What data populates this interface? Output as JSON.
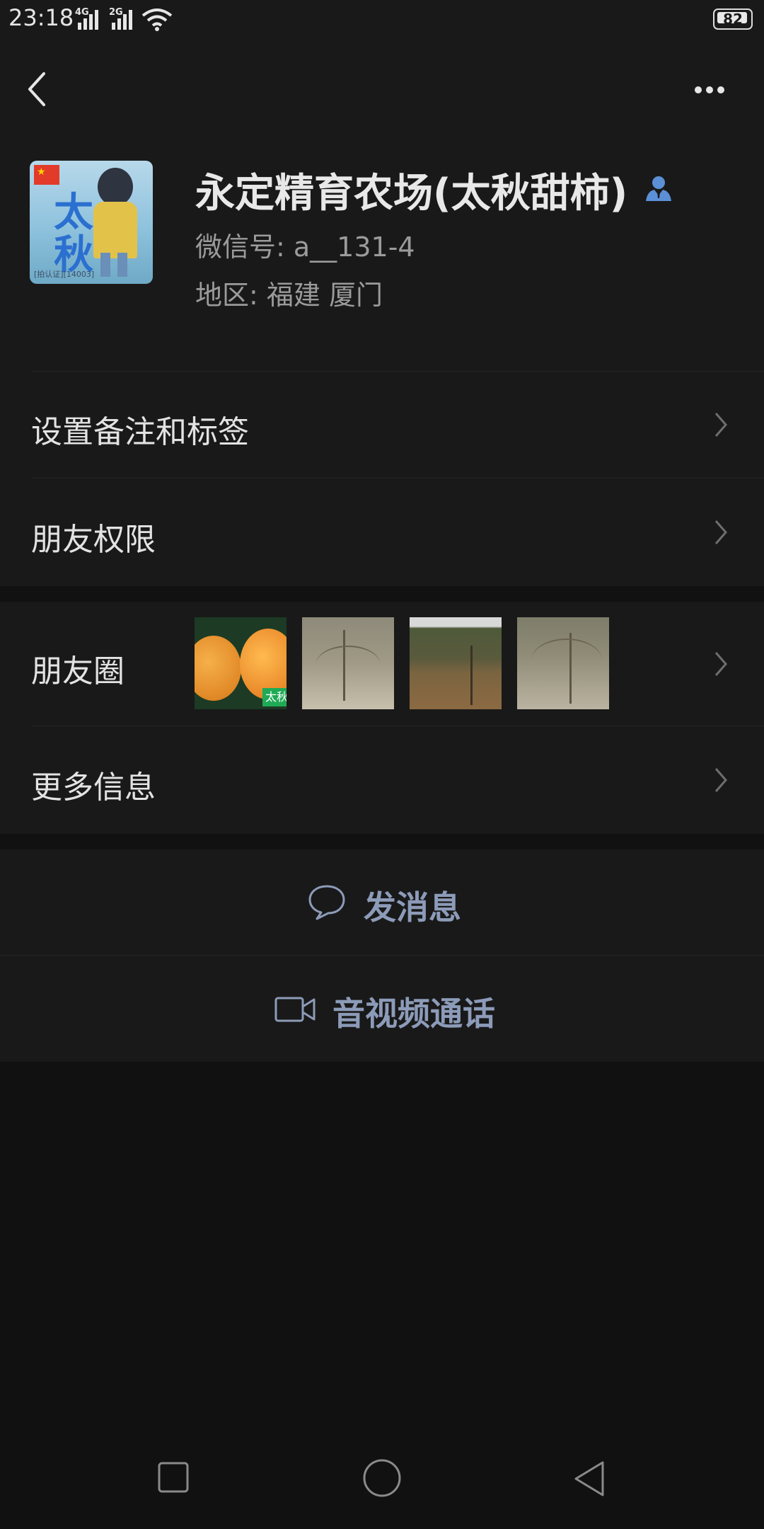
{
  "status_bar": {
    "time": "23:18",
    "network_1": "4G",
    "network_2": "2G",
    "battery": "82",
    "icons": [
      "signal-icon",
      "signal-icon",
      "wifi-icon",
      "battery-icon"
    ]
  },
  "nav": {
    "back_icon": "chevron-left-icon",
    "more_icon": "more-dots-icon"
  },
  "profile": {
    "name": "永定精育农场(太秋甜柿)",
    "wechat_id": "微信号: a__131-4",
    "region": "地区: 福建  厦门",
    "avatar": {
      "text_1": "太",
      "text_2": "秋",
      "caption": "[拍认证][14003]"
    },
    "badge_icon": "user-badge-icon"
  },
  "menu": {
    "remark_label": "设置备注和标签",
    "permissions_label": "朋友权限",
    "moments_label": "朋友圈",
    "moments_thumb_tag": "太秋",
    "more_info_label": "更多信息"
  },
  "actions": {
    "message_label": "发消息",
    "call_label": "音视频通话"
  },
  "colors": {
    "background": "#111111",
    "cell": "#191919",
    "accent": "#8c9bb8",
    "badge": "#5b8fd6"
  },
  "system_nav": {
    "icons": [
      "recent-apps-icon",
      "home-icon",
      "back-triangle-icon"
    ]
  }
}
